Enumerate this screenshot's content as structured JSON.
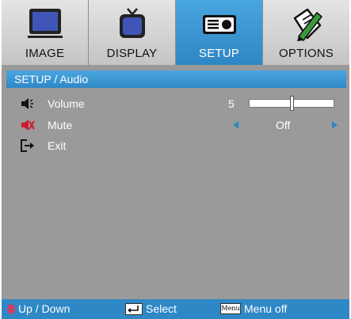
{
  "tabs": [
    {
      "label": "IMAGE",
      "icon": "monitor-icon",
      "active": false
    },
    {
      "label": "DISPLAY",
      "icon": "tv-icon",
      "active": false
    },
    {
      "label": "SETUP",
      "icon": "projector-icon",
      "active": true
    },
    {
      "label": "OPTIONS",
      "icon": "pencil-paper-icon",
      "active": false
    }
  ],
  "title": "SETUP / Audio",
  "items": {
    "volume": {
      "label": "Volume",
      "value": "5",
      "icon": "speaker-icon",
      "level_fraction": 0.5
    },
    "mute": {
      "label": "Mute",
      "value": "Off",
      "icon": "speaker-mute-icon"
    },
    "exit": {
      "label": "Exit",
      "icon": "exit-icon"
    }
  },
  "footer": {
    "updown": "Up / Down",
    "select": "Select",
    "menu_key": "Menu",
    "menu_off": "Menu off"
  },
  "colors": {
    "accent": "#2f86c4",
    "panel": "#9a9a9a",
    "up_down_arrow": "#e8335a"
  }
}
